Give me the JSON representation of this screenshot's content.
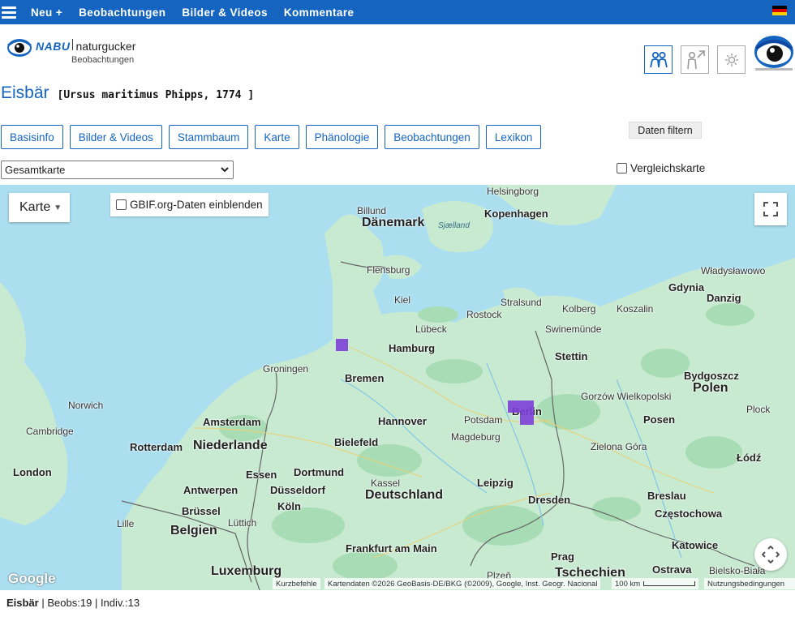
{
  "nav": {
    "items": [
      {
        "label": "Neu +"
      },
      {
        "label": "Beobachtungen"
      },
      {
        "label": "Bilder & Videos"
      },
      {
        "label": "Kommentare"
      }
    ],
    "flag_colors": [
      "#000000",
      "#dd0000",
      "#ffce00"
    ]
  },
  "header": {
    "logo_brand": "NABU",
    "logo_name": "naturgucker",
    "logo_sub": "Beobachtungen",
    "icons": [
      "people-icon",
      "male-arrow-icon",
      "sun-icon"
    ]
  },
  "species": {
    "common_name": "Eisbär",
    "scientific_name": "[Ursus maritimus Phipps, 1774 ]"
  },
  "tabs": [
    {
      "label": "Basisinfo"
    },
    {
      "label": "Bilder & Videos"
    },
    {
      "label": "Stammbaum"
    },
    {
      "label": "Karte"
    },
    {
      "label": "Phänologie"
    },
    {
      "label": "Beobachtungen"
    },
    {
      "label": "Lexikon"
    }
  ],
  "filter_label": "Daten filtern",
  "map_select": {
    "value": "Gesamtkarte"
  },
  "compare_label": "Vergleichskarte",
  "map": {
    "type_label": "Karte",
    "gbif_label": "GBIF.org-Daten einblenden",
    "logo": "Google",
    "shortcuts": "Kurzbefehle",
    "data_credit": "Kartendaten ©2026 GeoBasis-DE/BKG (©2009), Google, Inst. Geogr. Nacional",
    "scale": "100 km",
    "terms": "Nutzungsbedingungen",
    "colors": {
      "water": "#abdff0",
      "land": "#c8ead1",
      "forest": "#a8dcb4",
      "observation": "#7b3fd6"
    },
    "labels": [
      {
        "text": "Helsingborg",
        "kind": "city"
      },
      {
        "text": "Billund",
        "kind": "city"
      },
      {
        "text": "Dänemark",
        "kind": "country"
      },
      {
        "text": "Sjælland",
        "kind": "water"
      },
      {
        "text": "Kopenhagen",
        "kind": "big"
      },
      {
        "text": "Flensburg",
        "kind": "city"
      },
      {
        "text": "Władysławowo",
        "kind": "city"
      },
      {
        "text": "Gdynia",
        "kind": "big"
      },
      {
        "text": "Danzig",
        "kind": "big"
      },
      {
        "text": "Kiel",
        "kind": "city"
      },
      {
        "text": "Stralsund",
        "kind": "city"
      },
      {
        "text": "Rostock",
        "kind": "city"
      },
      {
        "text": "Kolberg",
        "kind": "city"
      },
      {
        "text": "Koszalin",
        "kind": "city"
      },
      {
        "text": "Lübeck",
        "kind": "city"
      },
      {
        "text": "Swinemünde",
        "kind": "city"
      },
      {
        "text": "Hamburg",
        "kind": "big"
      },
      {
        "text": "Stettin",
        "kind": "big"
      },
      {
        "text": "Groningen",
        "kind": "city"
      },
      {
        "text": "Bremen",
        "kind": "big"
      },
      {
        "text": "Bydgoszcz",
        "kind": "big"
      },
      {
        "text": "Gorzów Wielkopolski",
        "kind": "city"
      },
      {
        "text": "Polen",
        "kind": "country"
      },
      {
        "text": "Norwich",
        "kind": "city"
      },
      {
        "text": "Berlin",
        "kind": "big"
      },
      {
        "text": "Plock",
        "kind": "city"
      },
      {
        "text": "Amsterdam",
        "kind": "big"
      },
      {
        "text": "Hannover",
        "kind": "big"
      },
      {
        "text": "Potsdam",
        "kind": "city"
      },
      {
        "text": "Posen",
        "kind": "big"
      },
      {
        "text": "Cambridge",
        "kind": "city"
      },
      {
        "text": "Rotterdam",
        "kind": "big"
      },
      {
        "text": "Niederlande",
        "kind": "country"
      },
      {
        "text": "Bielefeld",
        "kind": "big"
      },
      {
        "text": "Magdeburg",
        "kind": "city"
      },
      {
        "text": "Zielona Góra",
        "kind": "city"
      },
      {
        "text": "London",
        "kind": "big"
      },
      {
        "text": "Essen",
        "kind": "big"
      },
      {
        "text": "Dortmund",
        "kind": "big"
      },
      {
        "text": "Łódź",
        "kind": "big"
      },
      {
        "text": "Kassel",
        "kind": "city"
      },
      {
        "text": "Leipzig",
        "kind": "big"
      },
      {
        "text": "Antwerpen",
        "kind": "big"
      },
      {
        "text": "Düsseldorf",
        "kind": "big"
      },
      {
        "text": "Deutschland",
        "kind": "country"
      },
      {
        "text": "Breslau",
        "kind": "big"
      },
      {
        "text": "Dresden",
        "kind": "big"
      },
      {
        "text": "Köln",
        "kind": "big"
      },
      {
        "text": "Brüssel",
        "kind": "big"
      },
      {
        "text": "Częstochowa",
        "kind": "big"
      },
      {
        "text": "Lille",
        "kind": "city"
      },
      {
        "text": "Lüttich",
        "kind": "city"
      },
      {
        "text": "Belgien",
        "kind": "country"
      },
      {
        "text": "Frankfurt am Main",
        "kind": "big"
      },
      {
        "text": "Katowice",
        "kind": "big"
      },
      {
        "text": "Prag",
        "kind": "big"
      },
      {
        "text": "Luxemburg",
        "kind": "country"
      },
      {
        "text": "Plzeň",
        "kind": "city"
      },
      {
        "text": "Tschechien",
        "kind": "country"
      },
      {
        "text": "Ostrava",
        "kind": "big"
      },
      {
        "text": "Bielsko-Biała",
        "kind": "city"
      }
    ]
  },
  "footer": {
    "species": "Eisbär",
    "beobs": "Beobs:19",
    "indiv": "Indiv.:13"
  }
}
